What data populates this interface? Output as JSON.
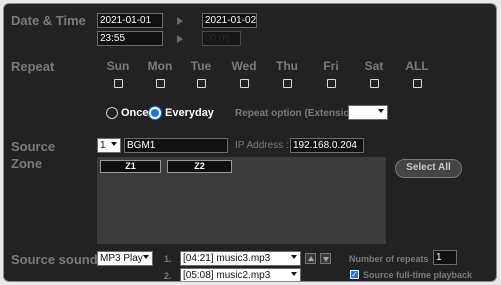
{
  "datetime": {
    "label": "Date & Time",
    "start_date": "2021-01-01",
    "end_date": "2021-01-02",
    "start_time": "23:55",
    "end_time": "00:05"
  },
  "repeat": {
    "label": "Repeat",
    "days": [
      "Sun",
      "Mon",
      "Tue",
      "Wed",
      "Thu",
      "Fri",
      "Sat",
      "ALL"
    ],
    "once_label": "Once",
    "everyday_label": "Everyday",
    "selected_mode": "Everyday",
    "option_label": "Repeat option (Extension)",
    "option_value": ""
  },
  "source": {
    "label": "Source",
    "number": "1",
    "name": "BGM1",
    "ip_label": "IP Address :",
    "ip_value": "192.168.0.204"
  },
  "zone": {
    "label": "Zone",
    "zones": [
      "Z1",
      "Z2"
    ],
    "select_all_label": "Select All"
  },
  "source_sound": {
    "label": "Source sound",
    "player": "MP3 Play",
    "tracks": [
      {
        "index": "1.",
        "value": "[04:21] music3.mp3"
      },
      {
        "index": "2.",
        "value": "[05:08] music2.mp3"
      }
    ],
    "repeats_label": "Number of repeats",
    "repeats_value": "1",
    "fulltime_label": "Source full-time playback"
  },
  "colors": {
    "panel_bg": "#222222",
    "radio_active": "#1a73e8",
    "label_grey": "#7b7b7b"
  }
}
